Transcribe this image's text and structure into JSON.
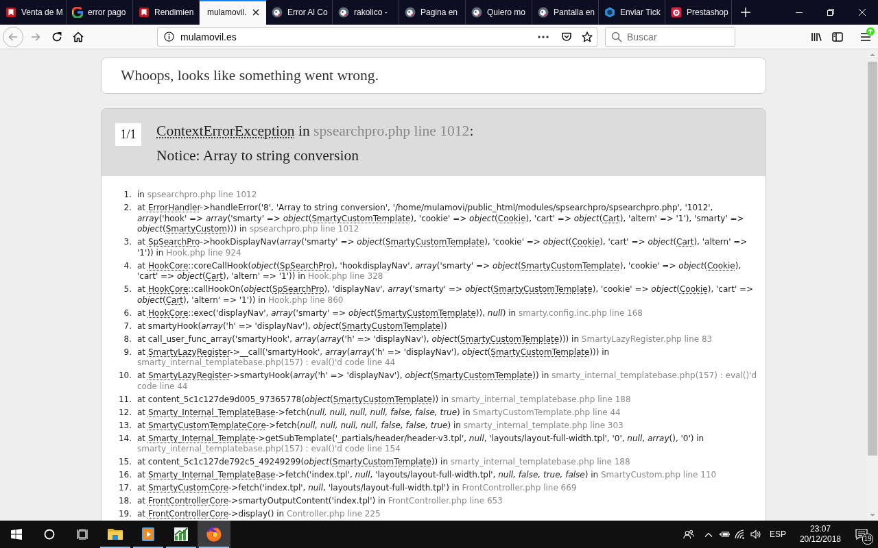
{
  "browser": {
    "tabs": [
      {
        "title": "Venta de M",
        "kind": "tile",
        "selected": false
      },
      {
        "title": "error pago",
        "kind": "g",
        "selected": false
      },
      {
        "title": "Rendimien",
        "kind": "tile",
        "selected": false
      },
      {
        "title": "mulamovil.",
        "kind": "blank",
        "selected": true
      },
      {
        "title": "Error Al Co",
        "kind": "mascot",
        "selected": false
      },
      {
        "title": "rakolico -",
        "kind": "mascot",
        "selected": false
      },
      {
        "title": "Pagina en",
        "kind": "mascot",
        "selected": false
      },
      {
        "title": "Quiero mo",
        "kind": "mascot",
        "selected": false
      },
      {
        "title": "Pantalla en",
        "kind": "mascot",
        "selected": false
      },
      {
        "title": "Enviar Tick",
        "kind": "hexagon",
        "selected": false
      },
      {
        "title": "Prestashop",
        "kind": "shop",
        "selected": false
      }
    ],
    "back": {
      "disabled": true
    },
    "forward": {
      "disabled": true
    },
    "address_bar": {
      "url": "mulamovil.es"
    },
    "search": {
      "placeholder": "Buscar"
    }
  },
  "page": {
    "heading": "Whoops, looks like something went wrong.",
    "exception": {
      "counter": "1/1",
      "title": [
        {
          "kind": "abbr",
          "text": "ContextErrorException"
        },
        {
          "kind": "code",
          "text": " in "
        },
        {
          "kind": "file",
          "text": "spsearchpro.php line 1012"
        },
        {
          "kind": "code",
          "text": ":"
        }
      ],
      "message": "Notice: Array to string conversion"
    },
    "trace": [
      {
        "number": "1.",
        "parts": [
          {
            "kind": "code",
            "text": "in "
          },
          {
            "kind": "file",
            "text": "spsearchpro.php line 1012"
          }
        ]
      },
      {
        "number": "2.",
        "parts": [
          {
            "kind": "code",
            "text": "at "
          },
          {
            "kind": "abbr",
            "text": "ErrorHandler"
          },
          {
            "kind": "code",
            "text": "->handleError('8', 'Array to string conversion', '/home/mulamovi/public_html/modules/spsearchpro/spsearchpro.php', '1012', "
          },
          {
            "kind": "em",
            "text": "array"
          },
          {
            "kind": "code",
            "text": "('hook' => "
          },
          {
            "kind": "em",
            "text": "array"
          },
          {
            "kind": "code",
            "text": "('smarty' => "
          },
          {
            "kind": "em",
            "text": "object"
          },
          {
            "kind": "code",
            "text": "("
          },
          {
            "kind": "abbr",
            "text": "SmartyCustomTemplate"
          },
          {
            "kind": "code",
            "text": "), 'cookie' => "
          },
          {
            "kind": "em",
            "text": "object"
          },
          {
            "kind": "code",
            "text": "("
          },
          {
            "kind": "abbr",
            "text": "Cookie"
          },
          {
            "kind": "code",
            "text": "), 'cart' => "
          },
          {
            "kind": "em",
            "text": "object"
          },
          {
            "kind": "code",
            "text": "("
          },
          {
            "kind": "abbr",
            "text": "Cart"
          },
          {
            "kind": "code",
            "text": "), 'altern' => '1'), 'smarty' => "
          },
          {
            "kind": "em",
            "text": "object"
          },
          {
            "kind": "code",
            "text": "("
          },
          {
            "kind": "abbr",
            "text": "SmartyCustom"
          },
          {
            "kind": "code",
            "text": "))) in "
          },
          {
            "kind": "file",
            "text": "spsearchpro.php line 1012"
          }
        ]
      },
      {
        "number": "3.",
        "parts": [
          {
            "kind": "code",
            "text": "at "
          },
          {
            "kind": "abbr",
            "text": "SpSearchPro"
          },
          {
            "kind": "code",
            "text": "->hookDisplayNav("
          },
          {
            "kind": "em",
            "text": "array"
          },
          {
            "kind": "code",
            "text": "('smarty' => "
          },
          {
            "kind": "em",
            "text": "object"
          },
          {
            "kind": "code",
            "text": "("
          },
          {
            "kind": "abbr",
            "text": "SmartyCustomTemplate"
          },
          {
            "kind": "code",
            "text": "), 'cookie' => "
          },
          {
            "kind": "em",
            "text": "object"
          },
          {
            "kind": "code",
            "text": "("
          },
          {
            "kind": "abbr",
            "text": "Cookie"
          },
          {
            "kind": "code",
            "text": "), 'cart' => "
          },
          {
            "kind": "em",
            "text": "object"
          },
          {
            "kind": "code",
            "text": "("
          },
          {
            "kind": "abbr",
            "text": "Cart"
          },
          {
            "kind": "code",
            "text": "), 'altern' => '1')) in "
          },
          {
            "kind": "file",
            "text": "Hook.php line 924"
          }
        ]
      },
      {
        "number": "4.",
        "parts": [
          {
            "kind": "code",
            "text": "at "
          },
          {
            "kind": "abbr",
            "text": "HookCore"
          },
          {
            "kind": "code",
            "text": "::coreCallHook("
          },
          {
            "kind": "em",
            "text": "object"
          },
          {
            "kind": "code",
            "text": "("
          },
          {
            "kind": "abbr",
            "text": "SpSearchPro"
          },
          {
            "kind": "code",
            "text": "), 'hookdisplayNav', "
          },
          {
            "kind": "em",
            "text": "array"
          },
          {
            "kind": "code",
            "text": "('smarty' => "
          },
          {
            "kind": "em",
            "text": "object"
          },
          {
            "kind": "code",
            "text": "("
          },
          {
            "kind": "abbr",
            "text": "SmartyCustomTemplate"
          },
          {
            "kind": "code",
            "text": "), 'cookie' => "
          },
          {
            "kind": "em",
            "text": "object"
          },
          {
            "kind": "code",
            "text": "("
          },
          {
            "kind": "abbr",
            "text": "Cookie"
          },
          {
            "kind": "code",
            "text": "), 'cart' => "
          },
          {
            "kind": "em",
            "text": "object"
          },
          {
            "kind": "code",
            "text": "("
          },
          {
            "kind": "abbr",
            "text": "Cart"
          },
          {
            "kind": "code",
            "text": "), 'altern' => '1')) in "
          },
          {
            "kind": "file",
            "text": "Hook.php line 328"
          }
        ]
      },
      {
        "number": "5.",
        "parts": [
          {
            "kind": "code",
            "text": "at "
          },
          {
            "kind": "abbr",
            "text": "HookCore"
          },
          {
            "kind": "code",
            "text": "::callHookOn("
          },
          {
            "kind": "em",
            "text": "object"
          },
          {
            "kind": "code",
            "text": "("
          },
          {
            "kind": "abbr",
            "text": "SpSearchPro"
          },
          {
            "kind": "code",
            "text": "), 'displayNav', "
          },
          {
            "kind": "em",
            "text": "array"
          },
          {
            "kind": "code",
            "text": "('smarty' => "
          },
          {
            "kind": "em",
            "text": "object"
          },
          {
            "kind": "code",
            "text": "("
          },
          {
            "kind": "abbr",
            "text": "SmartyCustomTemplate"
          },
          {
            "kind": "code",
            "text": "), 'cookie' => "
          },
          {
            "kind": "em",
            "text": "object"
          },
          {
            "kind": "code",
            "text": "("
          },
          {
            "kind": "abbr",
            "text": "Cookie"
          },
          {
            "kind": "code",
            "text": "), 'cart' => "
          },
          {
            "kind": "em",
            "text": "object"
          },
          {
            "kind": "code",
            "text": "("
          },
          {
            "kind": "abbr",
            "text": "Cart"
          },
          {
            "kind": "code",
            "text": "), 'altern' => '1')) in "
          },
          {
            "kind": "file",
            "text": "Hook.php line 860"
          }
        ]
      },
      {
        "number": "6.",
        "parts": [
          {
            "kind": "code",
            "text": "at "
          },
          {
            "kind": "abbr",
            "text": "HookCore"
          },
          {
            "kind": "code",
            "text": "::exec('displayNav', "
          },
          {
            "kind": "em",
            "text": "array"
          },
          {
            "kind": "code",
            "text": "('smarty' => "
          },
          {
            "kind": "em",
            "text": "object"
          },
          {
            "kind": "code",
            "text": "("
          },
          {
            "kind": "abbr",
            "text": "SmartyCustomTemplate"
          },
          {
            "kind": "code",
            "text": ")), "
          },
          {
            "kind": "em",
            "text": "null"
          },
          {
            "kind": "code",
            "text": ") in "
          },
          {
            "kind": "file",
            "text": "smarty.config.inc.php line 168"
          }
        ]
      },
      {
        "number": "7.",
        "parts": [
          {
            "kind": "code",
            "text": "at smartyHook("
          },
          {
            "kind": "em",
            "text": "array"
          },
          {
            "kind": "code",
            "text": "('h' => 'displayNav'), "
          },
          {
            "kind": "em",
            "text": "object"
          },
          {
            "kind": "code",
            "text": "("
          },
          {
            "kind": "abbr",
            "text": "SmartyCustomTemplate"
          },
          {
            "kind": "code",
            "text": "))"
          }
        ]
      },
      {
        "number": "8.",
        "parts": [
          {
            "kind": "code",
            "text": "at call_user_func_array('smartyHook', "
          },
          {
            "kind": "em",
            "text": "array"
          },
          {
            "kind": "code",
            "text": "("
          },
          {
            "kind": "em",
            "text": "array"
          },
          {
            "kind": "code",
            "text": "('h' => 'displayNav'), "
          },
          {
            "kind": "em",
            "text": "object"
          },
          {
            "kind": "code",
            "text": "("
          },
          {
            "kind": "abbr",
            "text": "SmartyCustomTemplate"
          },
          {
            "kind": "code",
            "text": "))) in "
          },
          {
            "kind": "file",
            "text": "SmartyLazyRegister.php line 83"
          }
        ]
      },
      {
        "number": "9.",
        "parts": [
          {
            "kind": "code",
            "text": "at "
          },
          {
            "kind": "abbr",
            "text": "SmartyLazyRegister"
          },
          {
            "kind": "code",
            "text": "->__call('smartyHook', "
          },
          {
            "kind": "em",
            "text": "array"
          },
          {
            "kind": "code",
            "text": "("
          },
          {
            "kind": "em",
            "text": "array"
          },
          {
            "kind": "code",
            "text": "('h' => 'displayNav'), "
          },
          {
            "kind": "em",
            "text": "object"
          },
          {
            "kind": "code",
            "text": "("
          },
          {
            "kind": "abbr",
            "text": "SmartyCustomTemplate"
          },
          {
            "kind": "code",
            "text": "))) in "
          },
          {
            "kind": "file",
            "text": "smarty_internal_templatebase.php(157) : eval()'d code line 44"
          }
        ]
      },
      {
        "number": "10.",
        "parts": [
          {
            "kind": "code",
            "text": "at "
          },
          {
            "kind": "abbr",
            "text": "SmartyLazyRegister"
          },
          {
            "kind": "code",
            "text": "->smartyHook("
          },
          {
            "kind": "em",
            "text": "array"
          },
          {
            "kind": "code",
            "text": "('h' => 'displayNav'), "
          },
          {
            "kind": "em",
            "text": "object"
          },
          {
            "kind": "code",
            "text": "("
          },
          {
            "kind": "abbr",
            "text": "SmartyCustomTemplate"
          },
          {
            "kind": "code",
            "text": ")) in "
          },
          {
            "kind": "file",
            "text": "smarty_internal_templatebase.php(157) : eval()'d code line 44"
          }
        ]
      },
      {
        "number": "11.",
        "parts": [
          {
            "kind": "code",
            "text": "at content_5c1c127de9d005_97365778("
          },
          {
            "kind": "em",
            "text": "object"
          },
          {
            "kind": "code",
            "text": "("
          },
          {
            "kind": "abbr",
            "text": "SmartyCustomTemplate"
          },
          {
            "kind": "code",
            "text": ")) in "
          },
          {
            "kind": "file",
            "text": "smarty_internal_templatebase.php line 188"
          }
        ]
      },
      {
        "number": "12.",
        "parts": [
          {
            "kind": "code",
            "text": "at "
          },
          {
            "kind": "abbr",
            "text": "Smarty_Internal_TemplateBase"
          },
          {
            "kind": "code",
            "text": "->fetch("
          },
          {
            "kind": "em",
            "text": "null, null, null, null, false, false, true"
          },
          {
            "kind": "code",
            "text": ") in "
          },
          {
            "kind": "file",
            "text": "SmartyCustomTemplate.php line 44"
          }
        ]
      },
      {
        "number": "13.",
        "parts": [
          {
            "kind": "code",
            "text": "at "
          },
          {
            "kind": "abbr",
            "text": "SmartyCustomTemplateCore"
          },
          {
            "kind": "code",
            "text": "->fetch("
          },
          {
            "kind": "em",
            "text": "null, null, null, null, false, false, true"
          },
          {
            "kind": "code",
            "text": ") in "
          },
          {
            "kind": "file",
            "text": "smarty_internal_template.php line 303"
          }
        ]
      },
      {
        "number": "14.",
        "parts": [
          {
            "kind": "code",
            "text": "at "
          },
          {
            "kind": "abbr",
            "text": "Smarty_Internal_Template"
          },
          {
            "kind": "code",
            "text": "->getSubTemplate('_partials/header/header-v3.tpl', "
          },
          {
            "kind": "em",
            "text": "null"
          },
          {
            "kind": "code",
            "text": ", 'layouts/layout-full-width.tpl', '0', "
          },
          {
            "kind": "em",
            "text": "null"
          },
          {
            "kind": "code",
            "text": ", "
          },
          {
            "kind": "em",
            "text": "array"
          },
          {
            "kind": "code",
            "text": "(), '0') in "
          },
          {
            "kind": "file",
            "text": "smarty_internal_templatebase.php(157) : eval()'d code line 154"
          }
        ]
      },
      {
        "number": "15.",
        "parts": [
          {
            "kind": "code",
            "text": "at content_5c1c127de792c5_49249299("
          },
          {
            "kind": "em",
            "text": "object"
          },
          {
            "kind": "code",
            "text": "("
          },
          {
            "kind": "abbr",
            "text": "SmartyCustomTemplate"
          },
          {
            "kind": "code",
            "text": ")) in "
          },
          {
            "kind": "file",
            "text": "smarty_internal_templatebase.php line 188"
          }
        ]
      },
      {
        "number": "16.",
        "parts": [
          {
            "kind": "code",
            "text": "at "
          },
          {
            "kind": "abbr",
            "text": "Smarty_Internal_TemplateBase"
          },
          {
            "kind": "code",
            "text": "->fetch('index.tpl', "
          },
          {
            "kind": "em",
            "text": "null"
          },
          {
            "kind": "code",
            "text": ", 'layouts/layout-full-width.tpl', "
          },
          {
            "kind": "em",
            "text": "null, false, true, false"
          },
          {
            "kind": "code",
            "text": ") in "
          },
          {
            "kind": "file",
            "text": "SmartyCustom.php line 110"
          }
        ]
      },
      {
        "number": "17.",
        "parts": [
          {
            "kind": "code",
            "text": "at "
          },
          {
            "kind": "abbr",
            "text": "SmartyCustomCore"
          },
          {
            "kind": "code",
            "text": "->fetch('index.tpl', "
          },
          {
            "kind": "em",
            "text": "null"
          },
          {
            "kind": "code",
            "text": ", 'layouts/layout-full-width.tpl') in "
          },
          {
            "kind": "file",
            "text": "FrontController.php line 669"
          }
        ]
      },
      {
        "number": "18.",
        "parts": [
          {
            "kind": "code",
            "text": "at "
          },
          {
            "kind": "abbr",
            "text": "FrontControllerCore"
          },
          {
            "kind": "code",
            "text": "->smartyOutputContent('index.tpl') in "
          },
          {
            "kind": "file",
            "text": "FrontController.php line 653"
          }
        ]
      },
      {
        "number": "19.",
        "parts": [
          {
            "kind": "code",
            "text": "at "
          },
          {
            "kind": "abbr",
            "text": "FrontControllerCore"
          },
          {
            "kind": "code",
            "text": "->display() in "
          },
          {
            "kind": "file",
            "text": "Controller.php line 225"
          }
        ]
      }
    ]
  },
  "taskbar": {
    "apps": [
      {
        "kind": "folder",
        "open": true,
        "selected": false
      },
      {
        "kind": "media",
        "open": true,
        "selected": false
      },
      {
        "kind": "chart",
        "open": true,
        "selected": false
      },
      {
        "kind": "browser",
        "open": true,
        "selected": true
      }
    ],
    "language": "ESP",
    "time": "23:07",
    "date": "20/12/2018",
    "notifications": "19"
  }
}
